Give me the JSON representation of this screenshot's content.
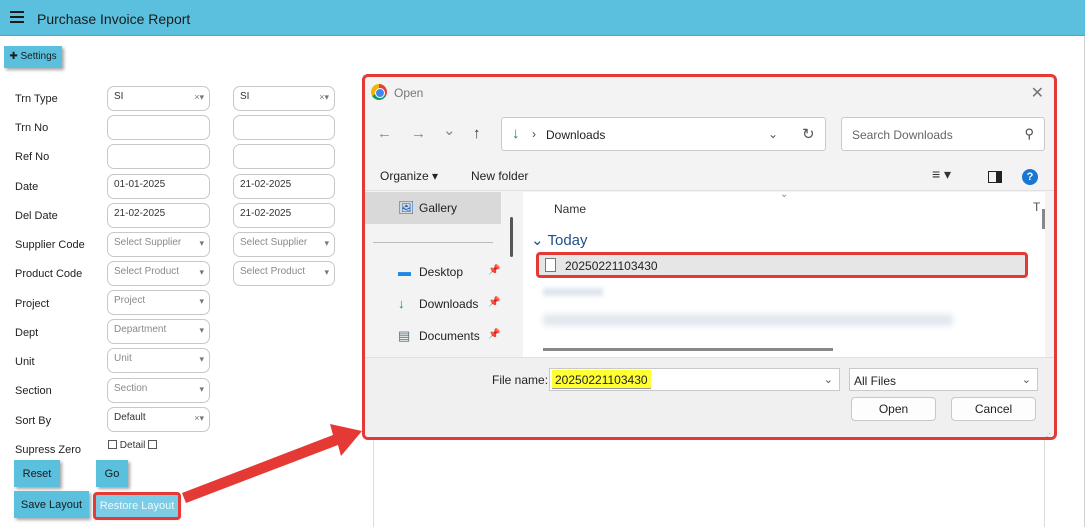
{
  "header": {
    "title": "Purchase Invoice Report"
  },
  "settings_label": "✚ Settings",
  "form": {
    "trn_type": {
      "label": "Trn Type",
      "from": "SI",
      "to": "SI"
    },
    "trn_no": {
      "label": "Trn No"
    },
    "ref_no": {
      "label": "Ref No"
    },
    "date": {
      "label": "Date",
      "from": "01-01-2025",
      "to": "21-02-2025"
    },
    "del_date": {
      "label": "Del Date",
      "from": "21-02-2025",
      "to": "21-02-2025"
    },
    "supplier_code": {
      "label": "Supplier Code",
      "placeholder": "Select Supplier"
    },
    "product_code": {
      "label": "Product Code",
      "placeholder": "Select Product"
    },
    "project": {
      "label": "Project",
      "placeholder": "Project"
    },
    "dept": {
      "label": "Dept",
      "placeholder": "Department"
    },
    "unit": {
      "label": "Unit",
      "placeholder": "Unit"
    },
    "section": {
      "label": "Section",
      "placeholder": "Section"
    },
    "sort_by": {
      "label": "Sort By",
      "value": "Default"
    },
    "supress_zero": {
      "label": "Supress Zero"
    },
    "detail_label": "Detail"
  },
  "buttons": {
    "reset": "Reset",
    "go": "Go",
    "save_layout": "Save Layout",
    "restore_layout": "Restore Layout"
  },
  "glyphs": {
    "clear_caret": "×▾",
    "caret": "▾"
  },
  "dialog": {
    "title": "Open",
    "close": "✕",
    "nav": {
      "back": "←",
      "forward": "→",
      "recent": "⌄",
      "up": "↑"
    },
    "address": {
      "icon": "↓",
      "separator": "›",
      "path": "Downloads",
      "dropdown": "⌄",
      "refresh": "↻"
    },
    "search": {
      "placeholder": "Search Downloads",
      "icon": "⚲"
    },
    "toolbar": {
      "organize": "Organize ▾",
      "new_folder": "New folder",
      "view": "≡ ▾",
      "help": "?"
    },
    "sidebar": [
      {
        "label": "Gallery",
        "icon": "🖼"
      },
      {
        "label": "Desktop",
        "icon": "▬"
      },
      {
        "label": "Downloads",
        "icon": "↓"
      },
      {
        "label": "Documents",
        "icon": "▤"
      }
    ],
    "sidebar_pin": "📌",
    "columns": {
      "name": "Name",
      "type": "T"
    },
    "group": "Today",
    "group_caret": "⌄",
    "file": "20250221103430",
    "file_name_label": "File name:",
    "file_name": "20250221103430",
    "file_type": "All Files",
    "open_btn": "Open",
    "cancel_btn": "Cancel"
  },
  "colors": {
    "accent": "#5bc0de",
    "highlight": "#e53935",
    "filename_highlight": "#ffff33"
  }
}
